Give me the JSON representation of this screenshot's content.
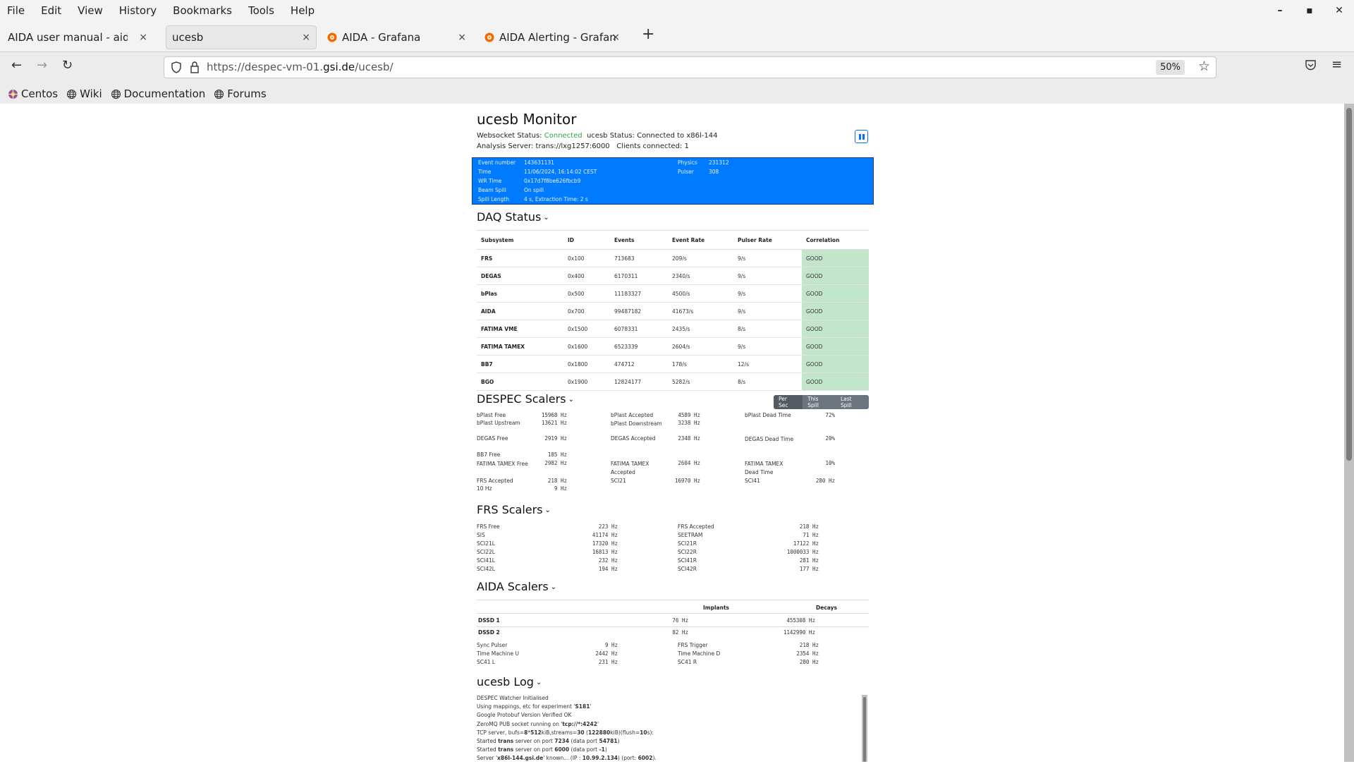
{
  "browser": {
    "menu": [
      "File",
      "Edit",
      "View",
      "History",
      "Bookmarks",
      "Tools",
      "Help"
    ],
    "window_controls": {
      "minimize": "–",
      "maximize": "▪",
      "close": "✕"
    },
    "tabs": [
      {
        "label": "AIDA user manual - aida_man",
        "active": false,
        "icon": "none"
      },
      {
        "label": "ucesb",
        "active": true,
        "icon": "none"
      },
      {
        "label": "AIDA - Grafana",
        "active": false,
        "icon": "grafana-icon"
      },
      {
        "label": "AIDA Alerting - Grafana",
        "active": false,
        "icon": "grafana-icon"
      }
    ],
    "tab_close": "×",
    "new_tab": "+",
    "url_prefix": "https://despec-vm-01.",
    "url_domain": "gsi.de",
    "url_path": "/ucesb/",
    "zoom": "50%",
    "bookmarks": [
      {
        "label": "Centos",
        "icon": "centos-icon"
      },
      {
        "label": "Wiki",
        "icon": "globe-icon"
      },
      {
        "label": "Documentation",
        "icon": "globe-icon"
      },
      {
        "label": "Forums",
        "icon": "globe-icon"
      }
    ]
  },
  "header": {
    "title": "ucesb Monitor",
    "ws_label": "Websocket Status:",
    "ws_value": "Connected",
    "ucesb_status": "ucesb Status: Connected to x86l-144",
    "analysis_server": "Analysis Server: trans://lxg1257:6000",
    "clients": "Clients connected: 1"
  },
  "info": {
    "event_number_label": "Event number",
    "event_number": "143631131",
    "time_label": "Time",
    "time": "11/06/2024, 16:14:02 CEST",
    "wr_time_label": "WR Time",
    "wr_time": "0x17d7f8be626fbcb9",
    "beam_spill_label": "Beam Spill",
    "beam_spill": "On spill",
    "spill_length_label": "Spill Length",
    "spill_length": "4 s, Extraction Time: 2 s",
    "physics_label": "Physics",
    "physics": "231312",
    "pulser_label": "Pulser",
    "pulser": "308"
  },
  "daq": {
    "title": "DAQ Status",
    "columns": [
      "Subsystem",
      "ID",
      "Events",
      "Event Rate",
      "Pulser Rate",
      "Correlation"
    ],
    "rows": [
      [
        "FRS",
        "0x100",
        "713683",
        "209/s",
        "9/s",
        "GOOD"
      ],
      [
        "DEGAS",
        "0x400",
        "6170311",
        "2340/s",
        "9/s",
        "GOOD"
      ],
      [
        "bPlas",
        "0x500",
        "11183327",
        "4500/s",
        "9/s",
        "GOOD"
      ],
      [
        "AIDA",
        "0x700",
        "99487182",
        "41673/s",
        "9/s",
        "GOOD"
      ],
      [
        "FATIMA VME",
        "0x1500",
        "6078331",
        "2435/s",
        "8/s",
        "GOOD"
      ],
      [
        "FATIMA TAMEX",
        "0x1600",
        "6523339",
        "2604/s",
        "9/s",
        "GOOD"
      ],
      [
        "BB7",
        "0x1800",
        "474712",
        "178/s",
        "12/s",
        "GOOD"
      ],
      [
        "BGO",
        "0x1900",
        "12824177",
        "5282/s",
        "8/s",
        "GOOD"
      ]
    ],
    "good_color": "#c3e6cb"
  },
  "despec": {
    "title": "DESPEC Scalers",
    "buttons": [
      "Per Sec",
      "This Spill",
      "Last Spill"
    ],
    "active_button": "Per Sec",
    "col1": [
      {
        "label": "bPlast Free",
        "value": "15968 Hz"
      },
      {
        "label": "bPlast Upstream",
        "value": "13621 Hz"
      },
      {
        "label": "DEGAS Free",
        "value": "2919 Hz"
      },
      {
        "label": "BB7 Free",
        "value": "185 Hz"
      },
      {
        "label": "FATIMA TAMEX Free",
        "value": "2982 Hz"
      },
      {
        "label": "FRS Accepted",
        "value": "218 Hz"
      },
      {
        "label": "10 Hz",
        "value": "9 Hz"
      }
    ],
    "col2": [
      {
        "label": "bPlast Accepted",
        "value": "4589 Hz"
      },
      {
        "label": "bPlast Downstream",
        "value": "3238 Hz"
      },
      {
        "label": "DEGAS Accepted",
        "value": "2348 Hz"
      },
      {
        "label": "FATIMA TAMEX Accepted",
        "value": "2604 Hz"
      },
      {
        "label": "SCI21",
        "value": "16970 Hz"
      }
    ],
    "col3": [
      {
        "label": "bPlast Dead Time",
        "value": "72%"
      },
      {
        "label": "DEGAS Dead Time",
        "value": "20%"
      },
      {
        "label": "FATIMA TAMEX Dead Time",
        "value": "10%"
      },
      {
        "label": "SCI41",
        "value": "280 Hz"
      }
    ]
  },
  "frs": {
    "title": "FRS Scalers",
    "left": [
      {
        "label": "FRS Free",
        "value": "223 Hz"
      },
      {
        "label": "SIS",
        "value": "41174 Hz"
      },
      {
        "label": "SCI21L",
        "value": "17320 Hz"
      },
      {
        "label": "SCI22L",
        "value": "16813 Hz"
      },
      {
        "label": "SCI41L",
        "value": "232 Hz"
      },
      {
        "label": "SCI42L",
        "value": "194 Hz"
      }
    ],
    "right": [
      {
        "label": "FRS Accepted",
        "value": "218 Hz"
      },
      {
        "label": "SEETRAM",
        "value": "71 Hz"
      },
      {
        "label": "SCI21R",
        "value": "17122 Hz"
      },
      {
        "label": "SCI22R",
        "value": "1000033 Hz"
      },
      {
        "label": "SCI41R",
        "value": "281 Hz"
      },
      {
        "label": "SCI42R",
        "value": "177 Hz"
      }
    ]
  },
  "aida": {
    "title": "AIDA Scalers",
    "col_implants": "Implants",
    "col_decays": "Decays",
    "dssd": [
      {
        "label": "DSSD 1",
        "implants": "76 Hz",
        "decays": "455308 Hz"
      },
      {
        "label": "DSSD 2",
        "implants": "82 Hz",
        "decays": "1142990 Hz"
      }
    ],
    "left": [
      {
        "label": "Sync Pulser",
        "value": "9 Hz"
      },
      {
        "label": "Time Machine U",
        "value": "2442 Hz"
      },
      {
        "label": "SC41 L",
        "value": "231 Hz"
      }
    ],
    "right": [
      {
        "label": "FRS Trigger",
        "value": "218 Hz"
      },
      {
        "label": "Time Machine D",
        "value": "2354 Hz"
      },
      {
        "label": "SC41 R",
        "value": "280 Hz"
      }
    ]
  },
  "log": {
    "title": "ucesb Log",
    "lines": [
      "DESPEC Watcher Initialised",
      "Using mappings, etc for experiment '<b>S181</b>'",
      "Google Protobuf Version Verified OK",
      "ZeroMQ PUB socket running on '<b>tcp://*:4242</b>'",
      "TCP server, bufs=<b>8</b>*<b>512</b>kiB,streams=<b>30</b> (<b>122880</b>kiB)(flush=<b>10</b>s):",
      "Started <b>trans</b> server on port <b>7234</b> (data port <b>54781</b>)",
      "Started <b>trans</b> server on port <b>6000</b> (data port <b>-1</b>)",
      "Server '<b>x86l-144.gsi.de</b>' known... (IP : <b>10.99.2.134</b>) (port: <b>6002</b>)."
    ]
  }
}
